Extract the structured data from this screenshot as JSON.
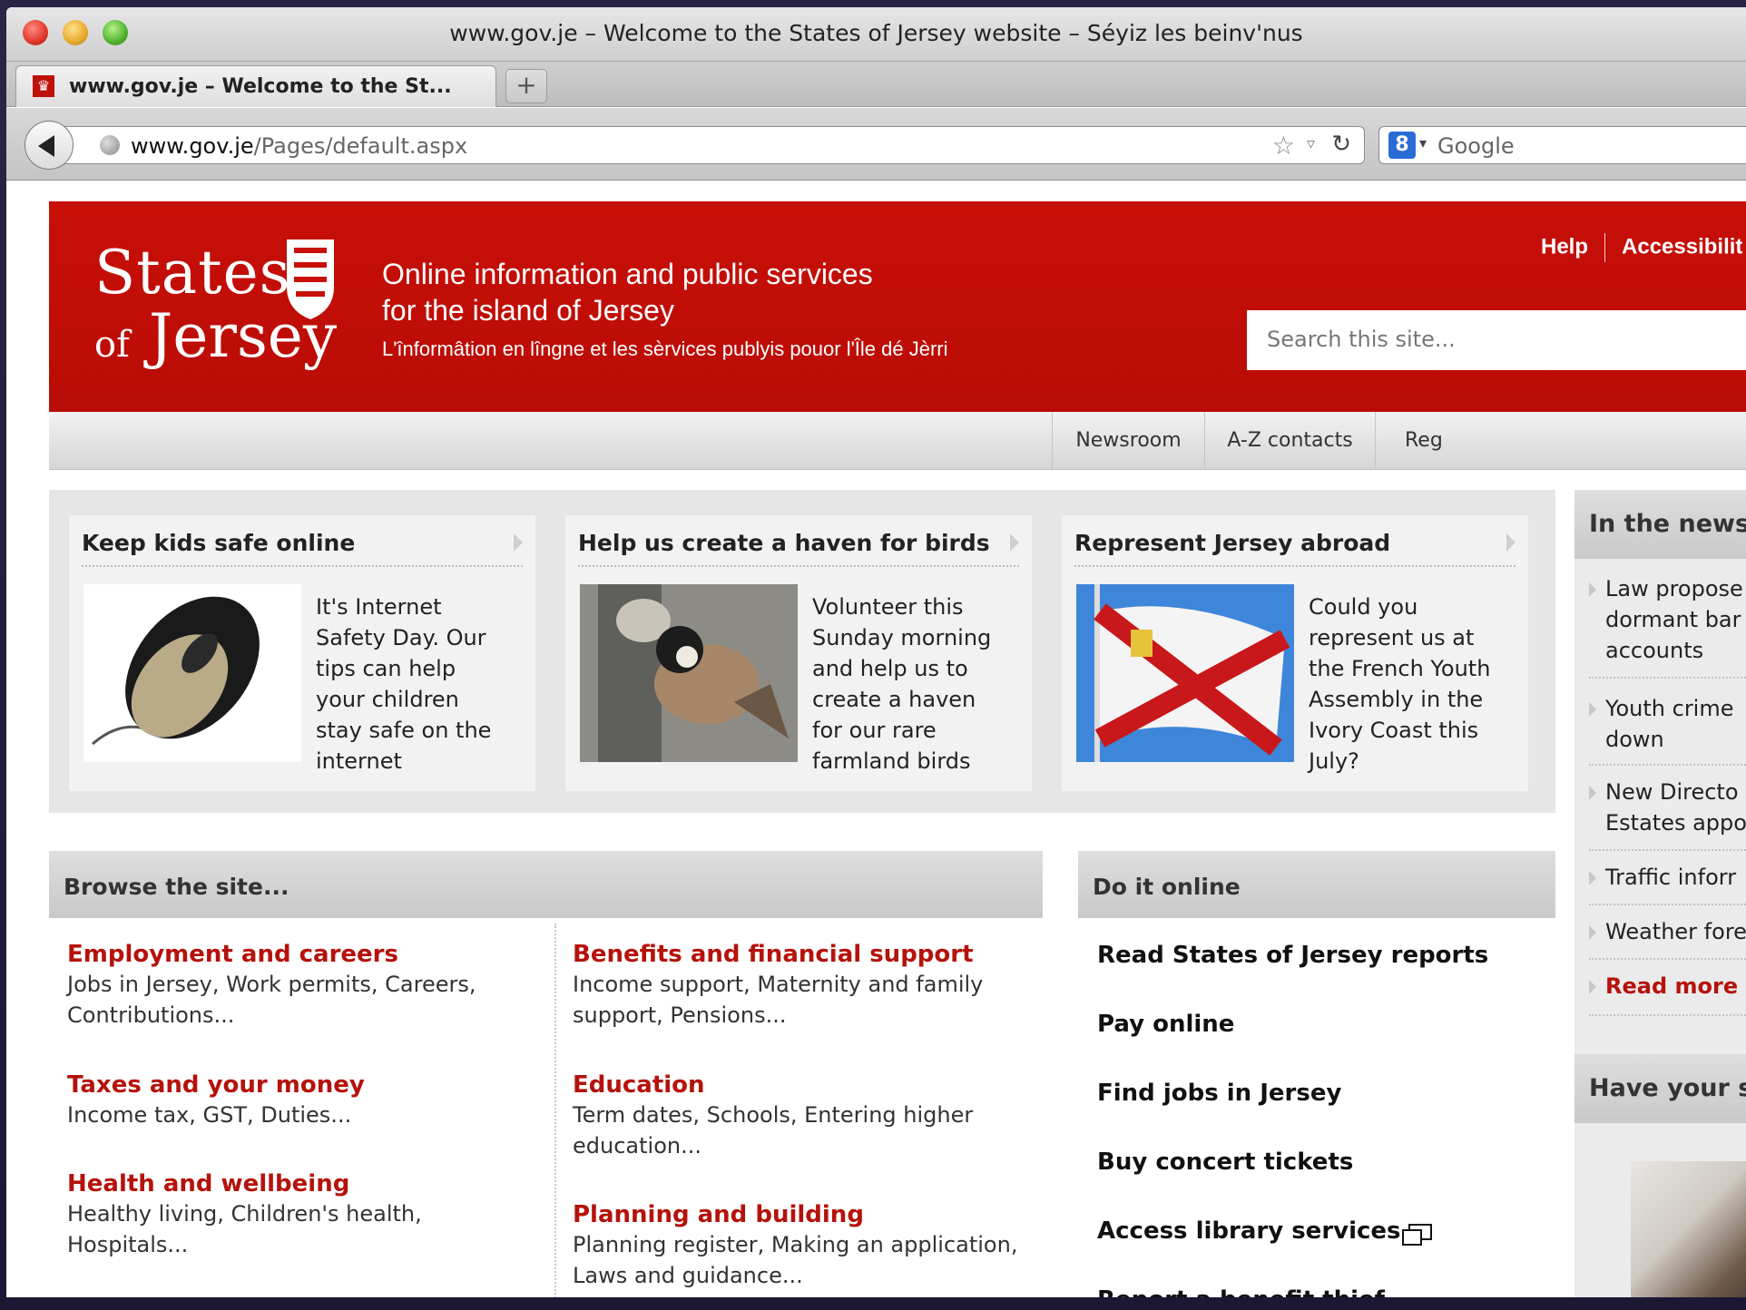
{
  "browser": {
    "window_title": "www.gov.je – Welcome to the States of Jersey website – Séyiz les beinv'nus",
    "tab_label": "www.gov.je – Welcome to the St...",
    "new_tab_label": "+",
    "url_host": "www.gov.je",
    "url_path": "/Pages/default.aspx",
    "search_engine_label": "Google"
  },
  "site": {
    "logo_line1": "States",
    "logo_line2_small": "of",
    "logo_line2": "Jersey",
    "tagline1": "Online information and public services",
    "tagline2": "for the island of Jersey",
    "tagline3": "L'înformâtion en lîngne et les sèrvices publyis pouor l'Île dé Jèrri",
    "util_links": [
      "Help",
      "Accessibilit"
    ],
    "search_placeholder": "Search this site...",
    "nav": [
      "Newsroom",
      "A-Z contacts",
      "Reg"
    ],
    "brand_color": "#c80f08"
  },
  "featured": [
    {
      "title": "Keep kids safe online",
      "lines": [
        "It's Internet",
        "Safety Day. Our",
        "tips can help",
        "your children",
        "stay safe on the",
        "internet"
      ],
      "image_icon": "computer-mouse"
    },
    {
      "title": "Help us create a haven for birds",
      "lines": [
        "Volunteer this",
        "Sunday morning",
        "and help us to",
        "create a haven",
        "for our rare",
        "farmland birds"
      ],
      "image_icon": "bird-on-feeder"
    },
    {
      "title": "Represent Jersey abroad",
      "lines": [
        "Could you",
        "represent us at",
        "the French Youth",
        "Assembly in the",
        "Ivory Coast this",
        "July?"
      ],
      "image_icon": "jersey-flag"
    }
  ],
  "browse": {
    "heading": "Browse the site...",
    "left": [
      {
        "title": "Employment and careers",
        "desc": [
          "Jobs in Jersey, Work permits, Careers,",
          "Contributions..."
        ]
      },
      {
        "title": "Taxes and your money",
        "desc": [
          "Income tax, GST, Duties..."
        ]
      },
      {
        "title": "Health and wellbeing",
        "desc": [
          "Healthy living, Children's health,",
          "Hospitals..."
        ]
      }
    ],
    "right": [
      {
        "title": "Benefits and financial support",
        "desc": [
          "Income support, Maternity and family",
          "support, Pensions..."
        ]
      },
      {
        "title": "Education",
        "desc": [
          "Term dates, Schools, Entering higher",
          "education..."
        ]
      },
      {
        "title": "Planning and building",
        "desc": [
          "Planning register, Making an application,",
          "Laws and guidance..."
        ]
      }
    ]
  },
  "online": {
    "heading": "Do it online",
    "links": [
      "Read States of Jersey reports",
      "Pay online",
      "Find jobs in Jersey",
      "Buy concert tickets",
      "Access library services",
      "Report a benefit thief"
    ]
  },
  "news": {
    "heading": "In the news",
    "items": [
      {
        "lines": [
          "Law propose",
          "dormant bar",
          "accounts"
        ]
      },
      {
        "lines": [
          "Youth crime",
          "down"
        ]
      },
      {
        "lines": [
          "New Directo",
          "Estates appo"
        ]
      },
      {
        "lines": [
          "Traffic inforr"
        ]
      },
      {
        "lines": [
          "Weather fore"
        ]
      }
    ],
    "more": "Read more",
    "say_heading": "Have your s"
  }
}
